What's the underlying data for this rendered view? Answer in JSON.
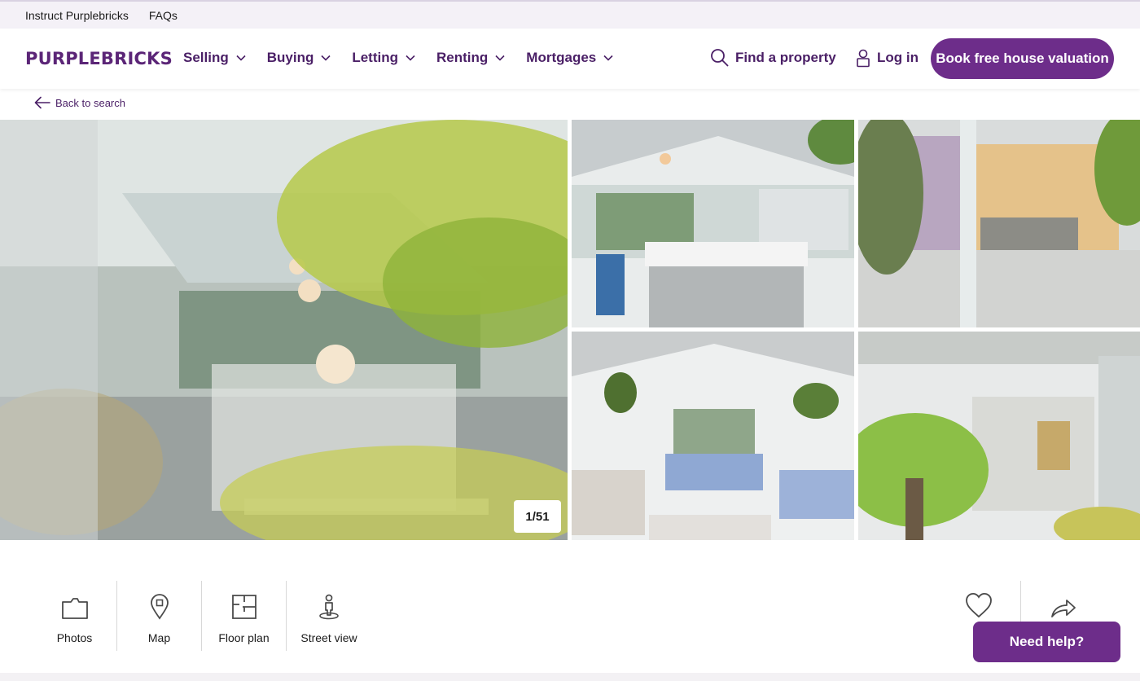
{
  "topbar": {
    "instruct": "Instruct Purplebricks",
    "faqs": "FAQs"
  },
  "nav": {
    "logo": "PURPLEBRICKS",
    "menu": [
      "Selling",
      "Buying",
      "Letting",
      "Renting",
      "Mortgages"
    ],
    "find_property": "Find a property",
    "login": "Log in",
    "book_valuation": "Book free house valuation"
  },
  "back_to_search": "Back to search",
  "gallery": {
    "counter": "1/51"
  },
  "tools": {
    "photos": "Photos",
    "map": "Map",
    "floor_plan": "Floor plan",
    "street_view": "Street view",
    "save": "S"
  },
  "help": "Need help?",
  "colors": {
    "brand": "#6d2d8a",
    "brand_text": "#4a1f66"
  }
}
